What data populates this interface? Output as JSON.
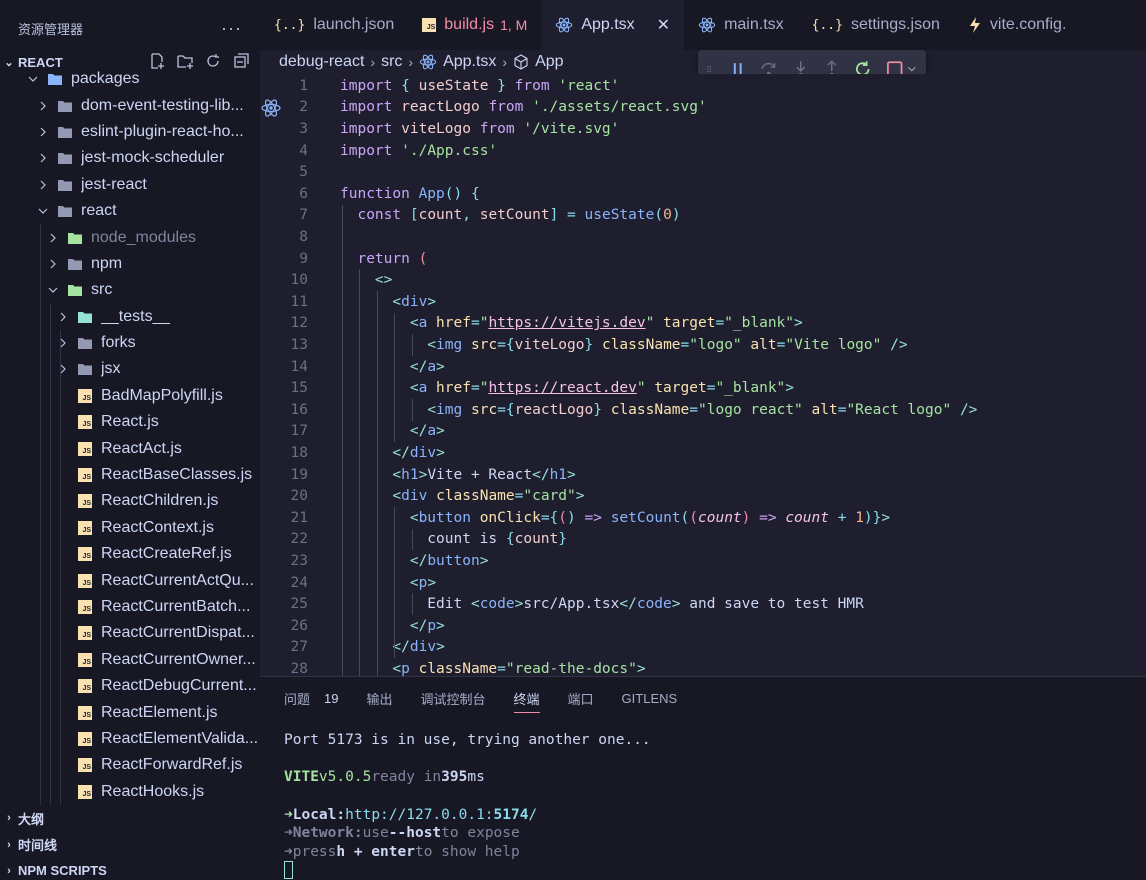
{
  "sidebar": {
    "title": "资源管理器",
    "more": "···",
    "section": "REACT",
    "tree": [
      {
        "label": "packages",
        "level": 1,
        "type": "folder-open",
        "icon": "packages-folder-icon"
      },
      {
        "label": "dom-event-testing-lib...",
        "level": 2,
        "type": "folder"
      },
      {
        "label": "eslint-plugin-react-ho...",
        "level": 2,
        "type": "folder"
      },
      {
        "label": "jest-mock-scheduler",
        "level": 2,
        "type": "folder"
      },
      {
        "label": "jest-react",
        "level": 2,
        "type": "folder"
      },
      {
        "label": "react",
        "level": 2,
        "type": "folder-open"
      },
      {
        "label": "node_modules",
        "level": 3,
        "type": "folder-node",
        "dim": true
      },
      {
        "label": "npm",
        "level": 3,
        "type": "folder"
      },
      {
        "label": "src",
        "level": 3,
        "type": "folder-src-open"
      },
      {
        "label": "__tests__",
        "level": 4,
        "type": "folder-tests"
      },
      {
        "label": "forks",
        "level": 4,
        "type": "folder"
      },
      {
        "label": "jsx",
        "level": 4,
        "type": "folder"
      },
      {
        "label": "BadMapPolyfill.js",
        "level": 4,
        "type": "js"
      },
      {
        "label": "React.js",
        "level": 4,
        "type": "js"
      },
      {
        "label": "ReactAct.js",
        "level": 4,
        "type": "js"
      },
      {
        "label": "ReactBaseClasses.js",
        "level": 4,
        "type": "js"
      },
      {
        "label": "ReactChildren.js",
        "level": 4,
        "type": "js"
      },
      {
        "label": "ReactContext.js",
        "level": 4,
        "type": "js"
      },
      {
        "label": "ReactCreateRef.js",
        "level": 4,
        "type": "js"
      },
      {
        "label": "ReactCurrentActQu...",
        "level": 4,
        "type": "js"
      },
      {
        "label": "ReactCurrentBatch...",
        "level": 4,
        "type": "js"
      },
      {
        "label": "ReactCurrentDispat...",
        "level": 4,
        "type": "js"
      },
      {
        "label": "ReactCurrentOwner...",
        "level": 4,
        "type": "js"
      },
      {
        "label": "ReactDebugCurrent...",
        "level": 4,
        "type": "js"
      },
      {
        "label": "ReactElement.js",
        "level": 4,
        "type": "js"
      },
      {
        "label": "ReactElementValida...",
        "level": 4,
        "type": "js"
      },
      {
        "label": "ReactForwardRef.js",
        "level": 4,
        "type": "js"
      },
      {
        "label": "ReactHooks.js",
        "level": 4,
        "type": "js"
      }
    ],
    "bottom_sections": [
      "大纲",
      "时间线",
      "NPM SCRIPTS"
    ],
    "js_badge": "JS"
  },
  "tabs": [
    {
      "label": "launch.json",
      "icon": "json",
      "state": "normal"
    },
    {
      "label": "build.js",
      "icon": "js",
      "state": "modified",
      "badge": "1, M"
    },
    {
      "label": "App.tsx",
      "icon": "react",
      "state": "active"
    },
    {
      "label": "main.tsx",
      "icon": "react",
      "state": "normal"
    },
    {
      "label": "settings.json",
      "icon": "json",
      "state": "normal"
    },
    {
      "label": "vite.config.",
      "icon": "vite",
      "state": "normal"
    }
  ],
  "breadcrumb": [
    "debug-react",
    "src",
    "App.tsx",
    "App"
  ],
  "editor": {
    "lines": [
      [
        [
          "k",
          "import"
        ],
        [
          "txt",
          " "
        ],
        [
          "o",
          "{"
        ],
        [
          "txt",
          " "
        ],
        [
          "v",
          "useState"
        ],
        [
          "txt",
          " "
        ],
        [
          "o",
          "}"
        ],
        [
          "txt",
          " "
        ],
        [
          "k",
          "from"
        ],
        [
          "txt",
          " "
        ],
        [
          "s",
          "'react'"
        ]
      ],
      [
        [
          "k",
          "import"
        ],
        [
          "txt",
          " "
        ],
        [
          "v",
          "reactLogo"
        ],
        [
          "txt",
          " "
        ],
        [
          "k",
          "from"
        ],
        [
          "txt",
          " "
        ],
        [
          "s",
          "'./assets/react.svg'"
        ]
      ],
      [
        [
          "k",
          "import"
        ],
        [
          "txt",
          " "
        ],
        [
          "v",
          "viteLogo"
        ],
        [
          "txt",
          " "
        ],
        [
          "k",
          "from"
        ],
        [
          "txt",
          " "
        ],
        [
          "s",
          "'/vite.svg'"
        ]
      ],
      [
        [
          "k",
          "import"
        ],
        [
          "txt",
          " "
        ],
        [
          "s",
          "'./App.css'"
        ]
      ],
      [],
      [
        [
          "k",
          "function"
        ],
        [
          "txt",
          " "
        ],
        [
          "f",
          "App"
        ],
        [
          "o",
          "()"
        ],
        [
          "txt",
          " "
        ],
        [
          "o",
          "{"
        ]
      ],
      [
        [
          "txt",
          "  "
        ],
        [
          "k",
          "const"
        ],
        [
          "txt",
          " "
        ],
        [
          "o",
          "["
        ],
        [
          "v",
          "count"
        ],
        [
          "o",
          ","
        ],
        [
          "txt",
          " "
        ],
        [
          "v",
          "setCount"
        ],
        [
          "o",
          "]"
        ],
        [
          "txt",
          " "
        ],
        [
          "o",
          "="
        ],
        [
          "txt",
          " "
        ],
        [
          "f",
          "useState"
        ],
        [
          "o",
          "("
        ],
        [
          "n",
          "0"
        ],
        [
          "o",
          ")"
        ]
      ],
      [],
      [
        [
          "txt",
          "  "
        ],
        [
          "k",
          "return"
        ],
        [
          "txt",
          " "
        ],
        [
          "br",
          "("
        ]
      ],
      [
        [
          "txt",
          "    "
        ],
        [
          "p",
          "<>"
        ]
      ],
      [
        [
          "txt",
          "      "
        ],
        [
          "p",
          "<"
        ],
        [
          "t",
          "div"
        ],
        [
          "p",
          ">"
        ]
      ],
      [
        [
          "txt",
          "        "
        ],
        [
          "p",
          "<"
        ],
        [
          "t",
          "a"
        ],
        [
          "txt",
          " "
        ],
        [
          "a",
          "href"
        ],
        [
          "o",
          "="
        ],
        [
          "s",
          "\""
        ],
        [
          "u",
          "https://vitejs.dev"
        ],
        [
          "s",
          "\""
        ],
        [
          "txt",
          " "
        ],
        [
          "a",
          "target"
        ],
        [
          "o",
          "="
        ],
        [
          "s",
          "\"_blank\""
        ],
        [
          "p",
          ">"
        ]
      ],
      [
        [
          "txt",
          "          "
        ],
        [
          "p",
          "<"
        ],
        [
          "t",
          "img"
        ],
        [
          "txt",
          " "
        ],
        [
          "a",
          "src"
        ],
        [
          "o",
          "={"
        ],
        [
          "v",
          "viteLogo"
        ],
        [
          "o",
          "}"
        ],
        [
          "txt",
          " "
        ],
        [
          "a",
          "className"
        ],
        [
          "o",
          "="
        ],
        [
          "s",
          "\"logo\""
        ],
        [
          "txt",
          " "
        ],
        [
          "a",
          "alt"
        ],
        [
          "o",
          "="
        ],
        [
          "s",
          "\"Vite logo\""
        ],
        [
          "txt",
          " "
        ],
        [
          "p",
          "/>"
        ]
      ],
      [
        [
          "txt",
          "        "
        ],
        [
          "p",
          "</"
        ],
        [
          "t",
          "a"
        ],
        [
          "p",
          ">"
        ]
      ],
      [
        [
          "txt",
          "        "
        ],
        [
          "p",
          "<"
        ],
        [
          "t",
          "a"
        ],
        [
          "txt",
          " "
        ],
        [
          "a",
          "href"
        ],
        [
          "o",
          "="
        ],
        [
          "s",
          "\""
        ],
        [
          "u",
          "https://react.dev"
        ],
        [
          "s",
          "\""
        ],
        [
          "txt",
          " "
        ],
        [
          "a",
          "target"
        ],
        [
          "o",
          "="
        ],
        [
          "s",
          "\"_blank\""
        ],
        [
          "p",
          ">"
        ]
      ],
      [
        [
          "txt",
          "          "
        ],
        [
          "p",
          "<"
        ],
        [
          "t",
          "img"
        ],
        [
          "txt",
          " "
        ],
        [
          "a",
          "src"
        ],
        [
          "o",
          "={"
        ],
        [
          "v",
          "reactLogo"
        ],
        [
          "o",
          "}"
        ],
        [
          "txt",
          " "
        ],
        [
          "a",
          "className"
        ],
        [
          "o",
          "="
        ],
        [
          "s",
          "\"logo react\""
        ],
        [
          "txt",
          " "
        ],
        [
          "a",
          "alt"
        ],
        [
          "o",
          "="
        ],
        [
          "s",
          "\"React logo\""
        ],
        [
          "txt",
          " "
        ],
        [
          "p",
          "/>"
        ]
      ],
      [
        [
          "txt",
          "        "
        ],
        [
          "p",
          "</"
        ],
        [
          "t",
          "a"
        ],
        [
          "p",
          ">"
        ]
      ],
      [
        [
          "txt",
          "      "
        ],
        [
          "p",
          "</"
        ],
        [
          "t",
          "div"
        ],
        [
          "p",
          ">"
        ]
      ],
      [
        [
          "txt",
          "      "
        ],
        [
          "p",
          "<"
        ],
        [
          "t",
          "h1"
        ],
        [
          "p",
          ">"
        ],
        [
          "txt",
          "Vite + React"
        ],
        [
          "p",
          "</"
        ],
        [
          "t",
          "h1"
        ],
        [
          "p",
          ">"
        ]
      ],
      [
        [
          "txt",
          "      "
        ],
        [
          "p",
          "<"
        ],
        [
          "t",
          "div"
        ],
        [
          "txt",
          " "
        ],
        [
          "a",
          "className"
        ],
        [
          "o",
          "="
        ],
        [
          "s",
          "\"card\""
        ],
        [
          "p",
          ">"
        ]
      ],
      [
        [
          "txt",
          "        "
        ],
        [
          "p",
          "<"
        ],
        [
          "t",
          "button"
        ],
        [
          "txt",
          " "
        ],
        [
          "a",
          "onClick"
        ],
        [
          "o",
          "={"
        ],
        [
          "br",
          "("
        ],
        [
          "o",
          ")"
        ],
        [
          "txt",
          " "
        ],
        [
          "k",
          "=>"
        ],
        [
          "txt",
          " "
        ],
        [
          "f",
          "setCount"
        ],
        [
          "o",
          "("
        ],
        [
          "br",
          "("
        ],
        [
          "i",
          "count"
        ],
        [
          "br",
          ")"
        ],
        [
          "txt",
          " "
        ],
        [
          "k",
          "=>"
        ],
        [
          "txt",
          " "
        ],
        [
          "i",
          "count"
        ],
        [
          "txt",
          " "
        ],
        [
          "o",
          "+"
        ],
        [
          "txt",
          " "
        ],
        [
          "n",
          "1"
        ],
        [
          "o",
          ")"
        ],
        [
          "o",
          "}"
        ],
        [
          "p",
          ">"
        ]
      ],
      [
        [
          "txt",
          "          count is "
        ],
        [
          "o",
          "{"
        ],
        [
          "v",
          "count"
        ],
        [
          "o",
          "}"
        ]
      ],
      [
        [
          "txt",
          "        "
        ],
        [
          "p",
          "</"
        ],
        [
          "t",
          "button"
        ],
        [
          "p",
          ">"
        ]
      ],
      [
        [
          "txt",
          "        "
        ],
        [
          "p",
          "<"
        ],
        [
          "t",
          "p"
        ],
        [
          "p",
          ">"
        ]
      ],
      [
        [
          "txt",
          "          Edit "
        ],
        [
          "p",
          "<"
        ],
        [
          "t",
          "code"
        ],
        [
          "p",
          ">"
        ],
        [
          "txt",
          "src/App.tsx"
        ],
        [
          "p",
          "</"
        ],
        [
          "t",
          "code"
        ],
        [
          "p",
          ">"
        ],
        [
          "txt",
          " and save to test HMR"
        ]
      ],
      [
        [
          "txt",
          "        "
        ],
        [
          "p",
          "</"
        ],
        [
          "t",
          "p"
        ],
        [
          "p",
          ">"
        ]
      ],
      [
        [
          "txt",
          "      "
        ],
        [
          "p",
          "</"
        ],
        [
          "t",
          "div"
        ],
        [
          "p",
          ">"
        ]
      ],
      [
        [
          "txt",
          "      "
        ],
        [
          "p",
          "<"
        ],
        [
          "t",
          "p"
        ],
        [
          "txt",
          " "
        ],
        [
          "a",
          "className"
        ],
        [
          "o",
          "="
        ],
        [
          "s",
          "\"read-the-docs\""
        ],
        [
          "p",
          ">"
        ]
      ]
    ]
  },
  "panel": {
    "tabs": [
      {
        "label": "问题",
        "badge": "19"
      },
      {
        "label": "输出"
      },
      {
        "label": "调试控制台"
      },
      {
        "label": "终端",
        "active": true
      },
      {
        "label": "端口"
      },
      {
        "label": "GITLENS"
      }
    ],
    "terminal": {
      "line1": "Port 5173 is in use, trying another one...",
      "vite": "VITE",
      "version": "v5.0.5",
      "ready": "ready in",
      "ms": "395",
      "ms_unit": "ms",
      "arrow": "➜",
      "local_label": "Local:",
      "local_url": "http://127.0.0.1:",
      "local_port": "5174",
      "local_slash": "/",
      "network_label": "Network:",
      "network_text1": "use",
      "network_flag": "--host",
      "network_text2": "to expose",
      "help_text1": "press",
      "help_key": "h + enter",
      "help_text2": "to show help"
    }
  }
}
